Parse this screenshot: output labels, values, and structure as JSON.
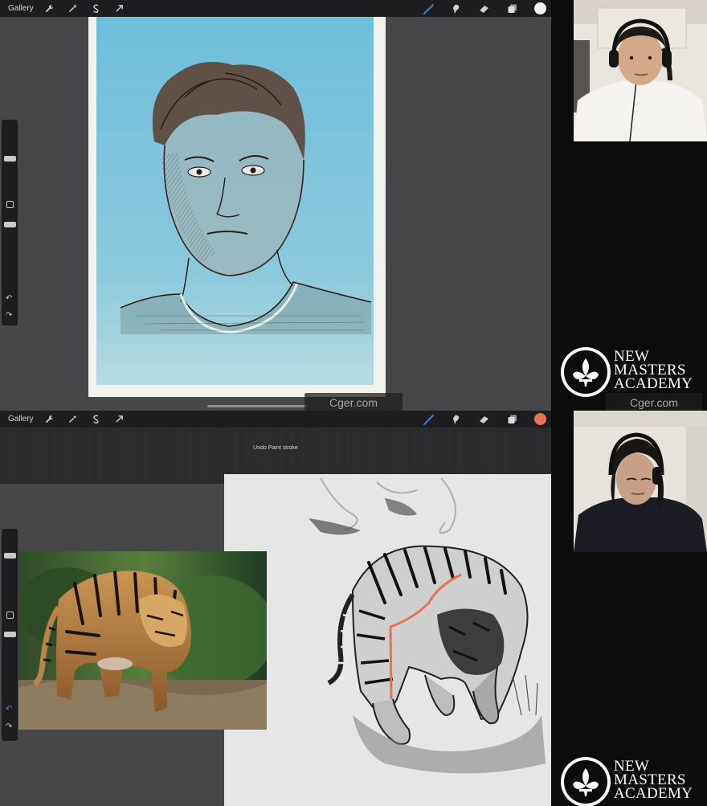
{
  "top_panel": {
    "toolbar": {
      "gallery_label": "Gallery",
      "left_tools": [
        "wrench-icon",
        "magic-wand-icon",
        "selection-icon",
        "transform-arrow-icon"
      ],
      "right_tools": [
        "brush-icon",
        "smudge-icon",
        "eraser-icon",
        "layers-icon"
      ],
      "color": "#f2f2f2"
    },
    "watermark": "Cger.com"
  },
  "bottom_panel": {
    "toolbar": {
      "gallery_label": "Gallery",
      "left_tools": [
        "wrench-icon",
        "magic-wand-icon",
        "selection-icon",
        "transform-arrow-icon"
      ],
      "right_tools": [
        "brush-icon",
        "smudge-icon",
        "eraser-icon",
        "layers-icon"
      ],
      "color": "#e8714f"
    },
    "undo_notice": "Undo Paint stroke"
  },
  "right_column": {
    "brand_top": {
      "line1": "NEW",
      "line2": "MASTERS",
      "line3": "ACADEMY"
    },
    "watermark": "Cger.com",
    "brand_bottom": {
      "line1": "NEW",
      "line2": "MASTERS",
      "line3": "ACADEMY"
    }
  },
  "colors": {
    "toolbar_bg": "#1d1d1f",
    "canvas_bg": "#474749",
    "accent_blue": "#3a7bd5",
    "paper_blue": "#7cc2dc",
    "highlight_stroke": "#e8714f"
  }
}
